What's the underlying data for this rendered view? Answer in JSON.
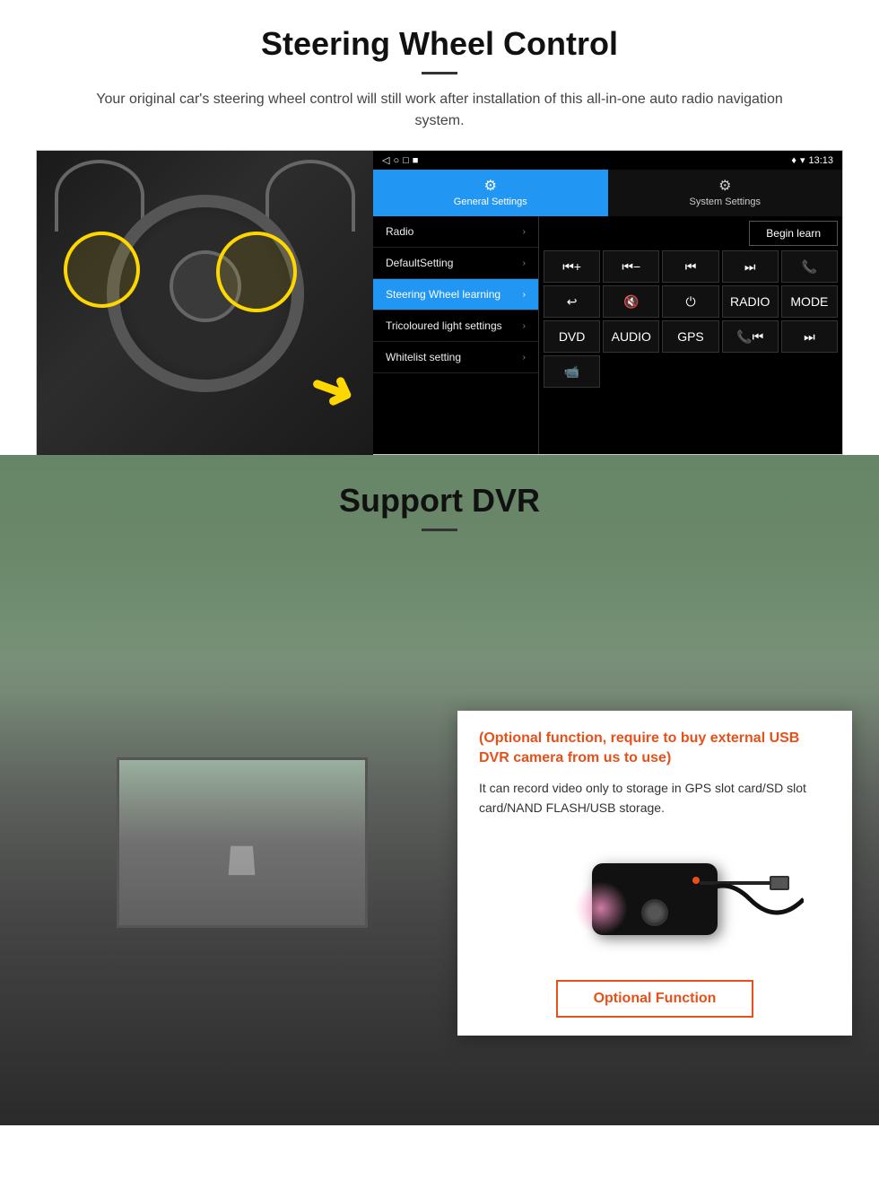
{
  "steering_section": {
    "title": "Steering Wheel Control",
    "subtitle": "Your original car's steering wheel control will still work after installation of this all-in-one auto radio navigation system.",
    "android_ui": {
      "status_bar": {
        "time": "13:13",
        "icons": [
          "▲",
          "▼",
          "□",
          "■",
          "♦",
          "▾",
          "📶"
        ]
      },
      "tabs": [
        {
          "label": "General Settings",
          "icon": "⚙",
          "active": true
        },
        {
          "label": "System Settings",
          "icon": "⚙",
          "active": false
        }
      ],
      "menu_items": [
        {
          "label": "Radio",
          "active": false
        },
        {
          "label": "DefaultSetting",
          "active": false
        },
        {
          "label": "Steering Wheel learning",
          "active": true
        },
        {
          "label": "Tricoloured light settings",
          "active": false
        },
        {
          "label": "Whitelist setting",
          "active": false
        }
      ],
      "begin_learn_label": "Begin learn",
      "control_buttons": [
        {
          "icon": "⏮+",
          "label": "vol+"
        },
        {
          "icon": "⏮-",
          "label": "vol-"
        },
        {
          "icon": "⏮",
          "label": "prev"
        },
        {
          "icon": "⏭",
          "label": "next"
        },
        {
          "icon": "📞",
          "label": "phone"
        },
        {
          "icon": "↩",
          "label": "back"
        },
        {
          "icon": "🔇",
          "label": "mute"
        },
        {
          "icon": "⏻",
          "label": "power"
        },
        {
          "icon": "RADIO",
          "label": "radio"
        },
        {
          "icon": "MODE",
          "label": "mode"
        },
        {
          "icon": "DVD",
          "label": "dvd"
        },
        {
          "icon": "AUDIO",
          "label": "audio"
        },
        {
          "icon": "GPS",
          "label": "gps"
        },
        {
          "icon": "📞⏮",
          "label": "tel-prev"
        },
        {
          "icon": "⏭",
          "label": "tel-next"
        },
        {
          "icon": "📹",
          "label": "dvr"
        }
      ]
    }
  },
  "dvr_section": {
    "title": "Support DVR",
    "optional_text": "(Optional function, require to buy external USB DVR camera from us to use)",
    "description": "It can record video only to storage in GPS slot card/SD slot card/NAND FLASH/USB storage.",
    "optional_function_label": "Optional Function"
  }
}
